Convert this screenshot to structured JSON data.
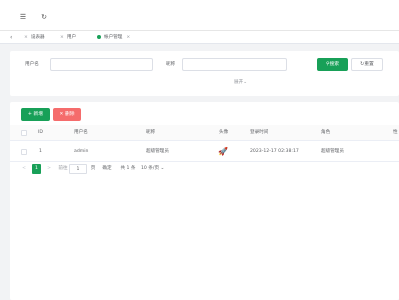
{
  "header": {
    "menu_icon": "menu-fold-icon",
    "refresh_icon": "refresh-icon"
  },
  "tabs": {
    "items": [
      {
        "label": "设表器"
      },
      {
        "label": "用户"
      },
      {
        "label": "帐户管理"
      }
    ]
  },
  "search": {
    "username_label": "用户名",
    "nickname_label": "昵称",
    "search_button": "搜索",
    "reset_button": "重置",
    "expand_label": "展开"
  },
  "toolbar": {
    "add_label": "+ 新增",
    "delete_label": "删除"
  },
  "table": {
    "columns": [
      "ID",
      "用户名",
      "昵称",
      "头像",
      "登录时间",
      "角色",
      "性"
    ],
    "rows": [
      {
        "id": "1",
        "username": "admin",
        "nickname": "超级管理员",
        "avatar": "🚀",
        "login_time": "2023-12-17 02:38:17",
        "role": "超级管理员"
      }
    ]
  },
  "pagination": {
    "prev": "<",
    "current": "1",
    "next": ">",
    "goto_label": "前往",
    "goto_value": "1",
    "page_unit": "页",
    "confirm": "确定",
    "total": "共 1 条",
    "page_size": "10 条/页"
  },
  "colors": {
    "primary": "#18a058",
    "danger": "#f56c6c"
  }
}
